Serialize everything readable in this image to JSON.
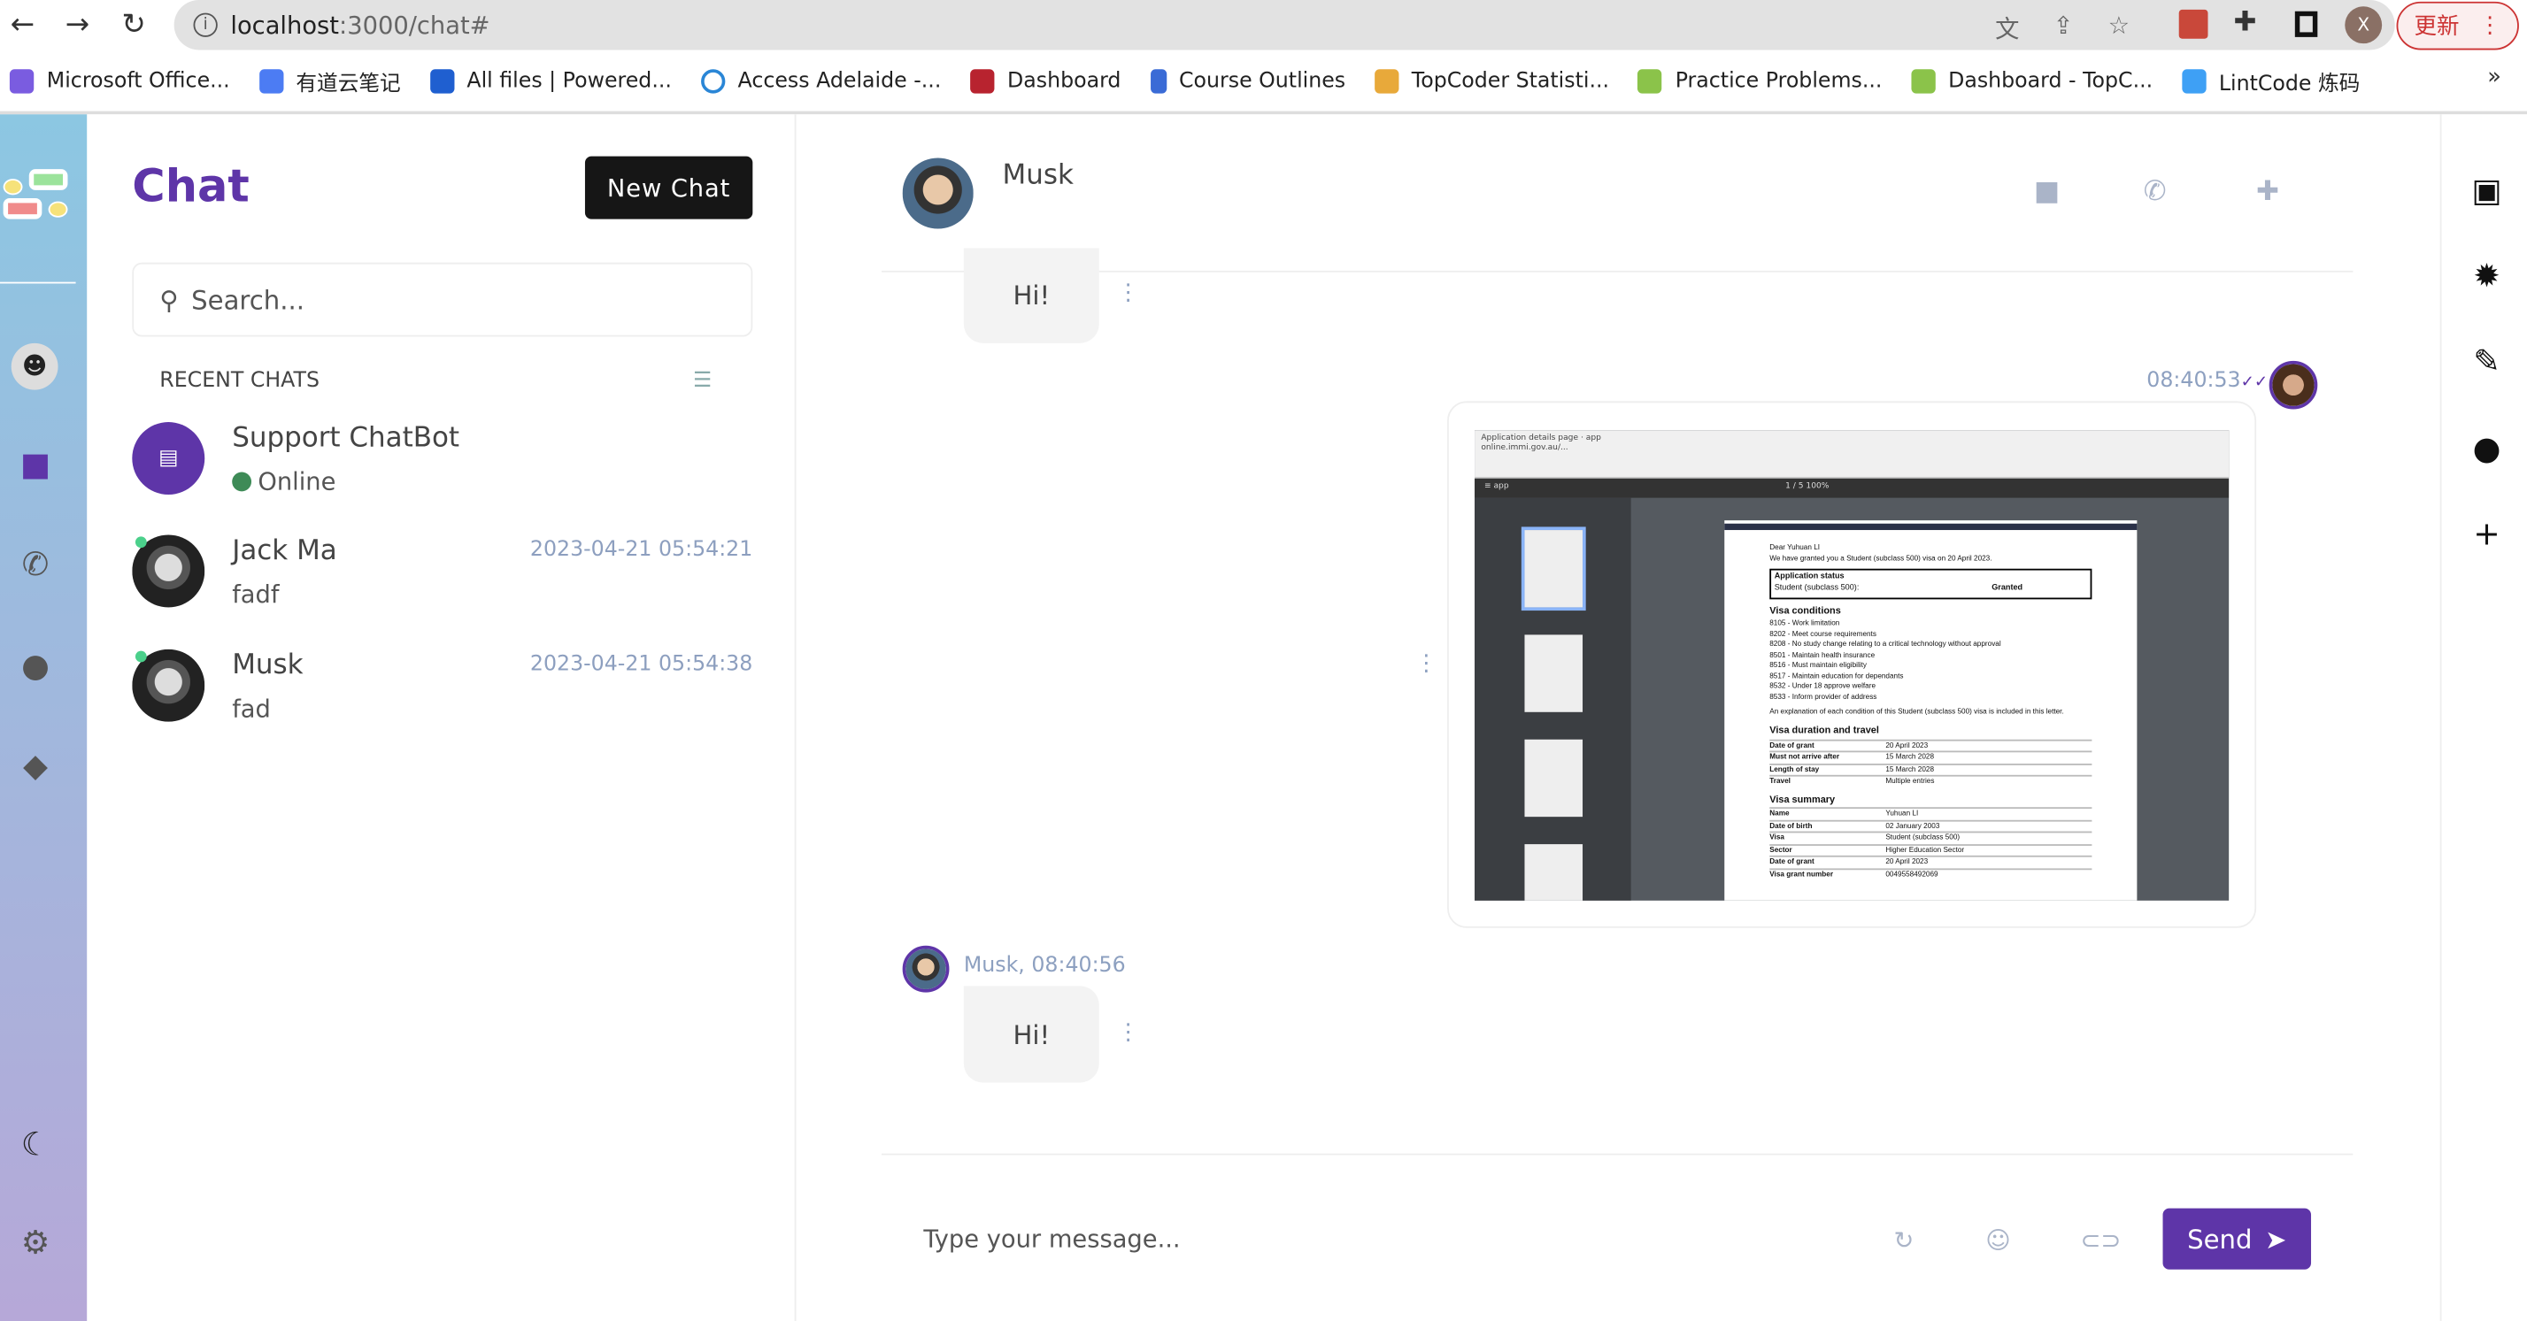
{
  "browser": {
    "url_host": "localhost",
    "url_path": ":3000/chat#",
    "update_label": "更新",
    "profile_initial": "X",
    "bookmarks": [
      {
        "label": "Microsoft Office...",
        "color": "#7a5ce0"
      },
      {
        "label": "有道云笔记",
        "color": "#4c7cf3"
      },
      {
        "label": "All files | Powered...",
        "color": "#1f5fd0"
      },
      {
        "label": "Access Adelaide -...",
        "color": "#2a86d6"
      },
      {
        "label": "Dashboard",
        "color": "#b8232f"
      },
      {
        "label": "Course Outlines",
        "color": "#3a6bd6"
      },
      {
        "label": "TopCoder Statisti...",
        "color": "#e8a93a"
      },
      {
        "label": "Practice Problems...",
        "color": "#8bc34a"
      },
      {
        "label": "Dashboard - TopC...",
        "color": "#8bc34a"
      },
      {
        "label": "LintCode 炼码",
        "color": "#3ea0f5"
      }
    ],
    "more": "»"
  },
  "sidebar": {
    "title": "Chat",
    "new_chat": "New Chat",
    "search_placeholder": "Search...",
    "recent_label": "RECENT CHATS",
    "chats": [
      {
        "name": "Support ChatBot",
        "status": "Online",
        "status_color": "#3e8b57"
      },
      {
        "name": "Jack Ma",
        "last": "fadf",
        "time": "2023-04-21 05:54:21"
      },
      {
        "name": "Musk",
        "last": "fad",
        "time": "2023-04-21 05:54:38"
      }
    ]
  },
  "conversation": {
    "contact": "Musk",
    "messages": [
      {
        "text": "Hi!"
      },
      {
        "time": "08:40:53",
        "type": "image"
      },
      {
        "meta": "Musk, 08:40:56",
        "text": "Hi!"
      }
    ],
    "composer_placeholder": "Type your message...",
    "send_label": "Send"
  },
  "attachment": {
    "tab1": "Application details page",
    "tab2": "app",
    "address": "online.immi.gov.au/...",
    "page_indicator": "1 / 5",
    "zoom": "100%",
    "greeting": "Dear Yuhuan LI",
    "intro": "We have granted you a Student (subclass 500) visa on 20 April 2023.",
    "status_heading": "Application status",
    "status_label": "Student (subclass 500):",
    "status_value": "Granted",
    "conditions_heading": "Visa conditions",
    "conditions": [
      "8105 - Work limitation",
      "8202 - Meet course requirements",
      "8208 - No study change relating to a critical technology without approval",
      "8501 - Maintain health insurance",
      "8516 - Must maintain eligibility",
      "8517 - Maintain education for dependants",
      "8532 - Under 18 approve welfare",
      "8533 - Inform provider of address"
    ],
    "explanation": "An explanation of each condition of this Student (subclass 500) visa is included in this letter.",
    "duration_heading": "Visa duration and travel",
    "duration": [
      [
        "Date of grant",
        "20 April 2023"
      ],
      [
        "Must not arrive after",
        "15 March 2028"
      ],
      [
        "Length of stay",
        "15 March 2028"
      ],
      [
        "Travel",
        "Multiple entries"
      ]
    ],
    "summary_heading": "Visa summary",
    "summary": [
      [
        "Name",
        "Yuhuan LI"
      ],
      [
        "Date of birth",
        "02 January 2003"
      ],
      [
        "Visa",
        "Student (subclass 500)"
      ],
      [
        "Sector",
        "Higher Education Sector"
      ],
      [
        "Date of grant",
        "20 April 2023"
      ],
      [
        "Visa grant number",
        "0049558492069"
      ]
    ]
  },
  "colors": {
    "accent": "#5e35a8",
    "timestamp": "#8da0c0"
  }
}
